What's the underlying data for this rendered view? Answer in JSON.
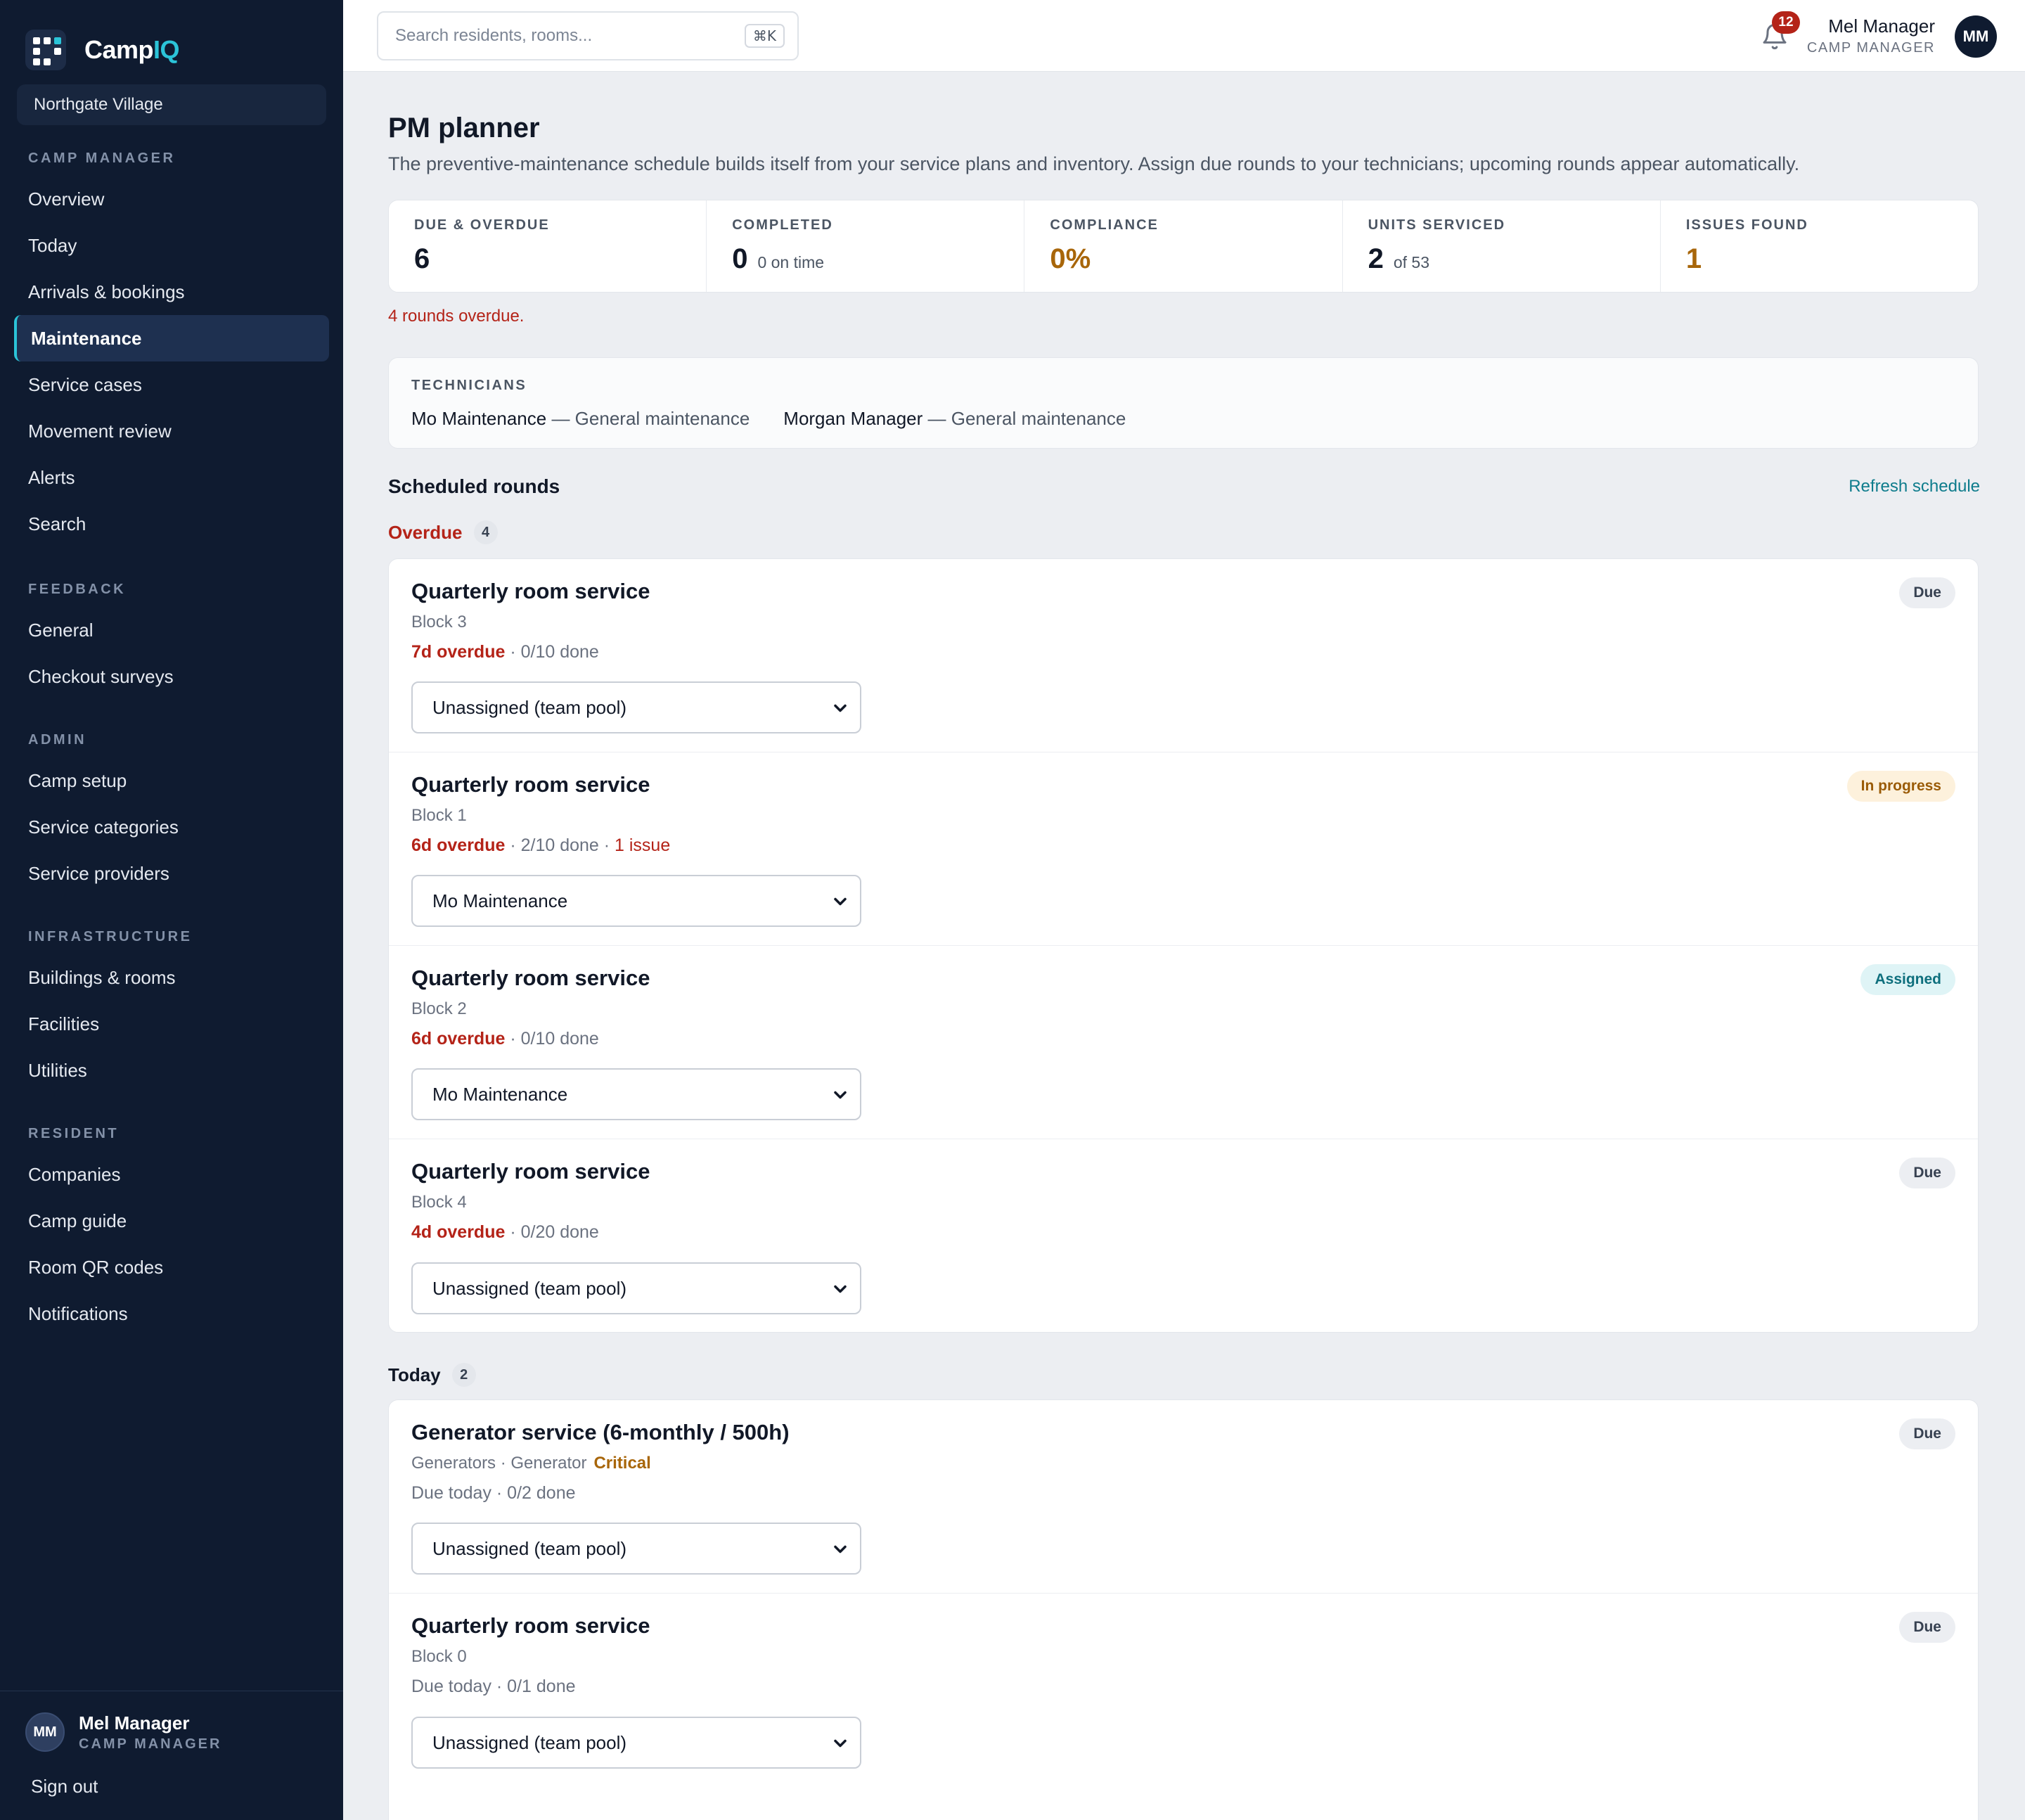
{
  "app": {
    "brand_prefix": "Camp",
    "brand_suffix": "IQ",
    "camp_name": "Northgate Village"
  },
  "sidebar": {
    "groups": [
      {
        "heading": "CAMP MANAGER",
        "items": [
          "Overview",
          "Today",
          "Arrivals & bookings",
          "Maintenance",
          "Service cases",
          "Movement review",
          "Alerts",
          "Search"
        ]
      },
      {
        "heading": "FEEDBACK",
        "items": [
          "General",
          "Checkout surveys"
        ]
      },
      {
        "heading": "ADMIN",
        "items": [
          "Camp setup",
          "Service categories",
          "Service providers"
        ]
      },
      {
        "heading": "INFRASTRUCTURE",
        "items": [
          "Buildings & rooms",
          "Facilities",
          "Utilities"
        ]
      },
      {
        "heading": "RESIDENT",
        "items": [
          "Companies",
          "Camp guide",
          "Room QR codes",
          "Notifications"
        ]
      }
    ],
    "active_item": "Maintenance",
    "footer": {
      "initials": "MM",
      "name": "Mel Manager",
      "role": "CAMP MANAGER",
      "sign_out": "Sign out"
    }
  },
  "topbar": {
    "search_placeholder": "Search residents, rooms...",
    "shortcut": "⌘K",
    "notification_count": "12",
    "user_name": "Mel Manager",
    "user_role": "CAMP MANAGER",
    "user_initials": "MM"
  },
  "page": {
    "title": "PM planner",
    "subtitle": "The preventive-maintenance schedule builds itself from your service plans and inventory. Assign due rounds to your technicians; upcoming rounds appear automatically."
  },
  "stats": [
    {
      "label": "DUE & OVERDUE",
      "value": "6",
      "sub": ""
    },
    {
      "label": "COMPLETED",
      "value": "0",
      "sub": "0 on time"
    },
    {
      "label": "COMPLIANCE",
      "value": "0%",
      "sub": ""
    },
    {
      "label": "UNITS SERVICED",
      "value": "2",
      "sub": "of 53"
    },
    {
      "label": "ISSUES FOUND",
      "value": "1",
      "sub": ""
    }
  ],
  "overdue_note": "4 rounds overdue.",
  "technicians": {
    "heading": "TECHNICIANS",
    "list": [
      {
        "name": "Mo Maintenance",
        "role": " — General maintenance"
      },
      {
        "name": "Morgan Manager",
        "role": " — General maintenance"
      }
    ]
  },
  "schedule": {
    "title": "Scheduled rounds",
    "refresh_label": "Refresh schedule",
    "overdue": {
      "label": "Overdue",
      "count": "4",
      "rounds": [
        {
          "title": "Quarterly room service",
          "location": "Block 3",
          "late": "7d overdue",
          "progress": " · 0/10 done",
          "issue": "",
          "assignee": "Unassigned (team pool)",
          "status": "Due"
        },
        {
          "title": "Quarterly room service",
          "location": "Block 1",
          "late": "6d overdue",
          "progress": " · 2/10 done · ",
          "issue": "1 issue",
          "assignee": "Mo Maintenance",
          "status": "In progress"
        },
        {
          "title": "Quarterly room service",
          "location": "Block 2",
          "late": "6d overdue",
          "progress": " · 0/10 done",
          "issue": "",
          "assignee": "Mo Maintenance",
          "status": "Assigned"
        },
        {
          "title": "Quarterly room service",
          "location": "Block 4",
          "late": "4d overdue",
          "progress": " · 0/20 done",
          "issue": "",
          "assignee": "Unassigned (team pool)",
          "status": "Due"
        }
      ]
    },
    "today": {
      "label": "Today",
      "count": "2",
      "rounds": [
        {
          "title": "Generator service (6-monthly / 500h)",
          "location": "Generators · Generator",
          "critical": "Critical",
          "meta": "Due today · 0/2 done",
          "assignee": "Unassigned (team pool)",
          "status": "Due"
        },
        {
          "title": "Quarterly room service",
          "location": "Block 0",
          "critical": "",
          "meta": "Due today · 0/1 done",
          "assignee": "Unassigned (team pool)",
          "status": "Due"
        }
      ]
    }
  },
  "colors": {
    "sidebar_bg": "#0f1b30",
    "accent": "#2bc4d8",
    "danger": "#b42318",
    "warning": "#a8660a"
  }
}
